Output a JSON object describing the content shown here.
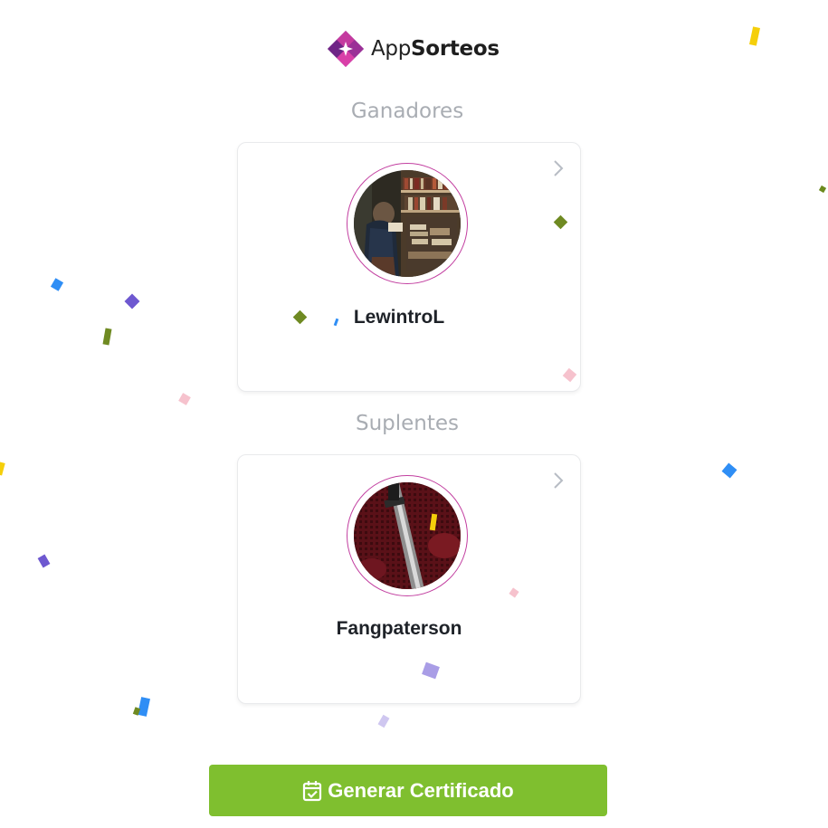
{
  "brand": {
    "name_regular": "App",
    "name_bold": "Sorteos",
    "logo_colors": [
      "#7b2d8e",
      "#b5309a",
      "#d63aa7"
    ]
  },
  "sections": {
    "winners_title": "Ganadores",
    "subs_title": "Suplentes"
  },
  "winners": [
    {
      "username": "LewintroL",
      "avatar_icon": "bookshelf-photo-avatar"
    }
  ],
  "substitutes": [
    {
      "username": "Fangpaterson",
      "avatar_icon": "sword-photo-avatar"
    }
  ],
  "actions": {
    "certificate_label": "Generar Certificado",
    "certificate_icon": "calendar-check-icon",
    "button_color": "#7fbf2f"
  },
  "colors": {
    "section_title": "#a9adb3",
    "avatar_ring": "#c23fa0",
    "text": "#1e2228"
  }
}
